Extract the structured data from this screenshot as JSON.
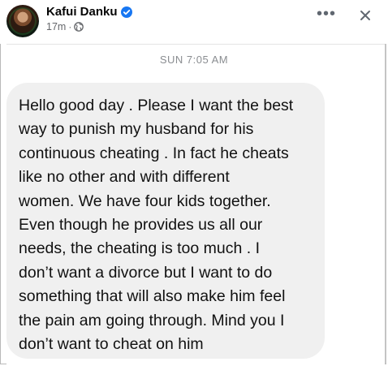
{
  "post": {
    "author": "Kafui Danku",
    "time": "17m",
    "separator": "·",
    "more": "•••",
    "close": "×"
  },
  "chat": {
    "timestamp": "SUN 7:05 AM",
    "message_lines": [
      "Hello good day . Please I want the best",
      "way to punish my husband for his",
      "continuous cheating . In fact he cheats",
      "like no other and with different",
      "women. We have four kids together.",
      "Even though he provides us all our",
      "needs, the cheating is too much . I",
      "don’t want a divorce but I want to do",
      "something that will also make him feel",
      "the pain am going through. Mind you I",
      "don’t want to cheat on him"
    ]
  },
  "colors": {
    "verified_badge": "#1877f2",
    "bubble_bg": "#f0f0f0",
    "meta_text": "#65676b",
    "timestamp_text": "#8a8d91"
  },
  "icons": {
    "verified": "verified-badge-icon",
    "audience": "globe-icon",
    "more": "more-options-icon",
    "close": "close-icon"
  }
}
